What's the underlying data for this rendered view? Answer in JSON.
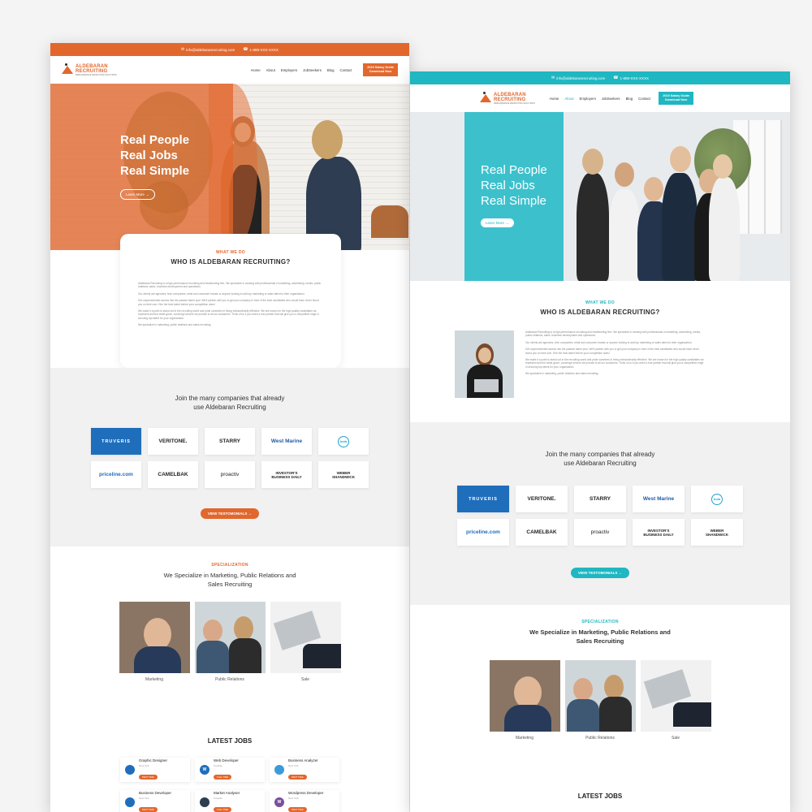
{
  "topbar": {
    "email": "info@aldebaranrecruiting.com",
    "phone": "1-888-XXX-XXXX"
  },
  "logo": {
    "name": "ALDEBARAN",
    "line2": "RECRUITING",
    "tagline": "PERFORMANCE RECRUITING SOLUTIONS"
  },
  "nav": {
    "items": [
      "Home",
      "About",
      "Employers",
      "JobSeekers",
      "Blog",
      "Contact"
    ],
    "cta_line1": "2019 Salary Guide",
    "cta_line2": "Download Now"
  },
  "hero": {
    "line1": "Real People",
    "line2": "Real Jobs",
    "line3": "Real Simple",
    "button": "Learn More →"
  },
  "about": {
    "eyebrow": "WHAT WE DO",
    "title": "WHO IS ALDEBARAN RECRUITING?",
    "p1": "Aldebaran Recruiting is a high-performance recruiting and headhunting firm. We specialize in working with professionals in marketing, advertising, media, public relations, sales, business development and operations.",
    "p2": "Our clients are agencies, tech companies, retail and consumer brands or anyone looking to add top marketing or sales talent to their organization.",
    "p3": "Get unprecedented access into the passive talent pool. We'll partner with you to get your company in front of the best candidates who would have never found you on their own. Hire the best talent before your competition does!",
    "p4": "We make it a point to stand out in the recruiting world and pride ourselves in being extraordinarily effective. We are known for the high quality candidates we represent and the white-glove, concierge service we provide to all our customers. Think of us if you need a true partner that will give you a competitive edge in securing top talent for your organization.",
    "p5": "We specialize in marketing, public relations and sales recruiting."
  },
  "clients": {
    "title_line1": "Join the many companies that already",
    "title_line2": "use Aldebaran Recruiting",
    "logos": [
      "TRUVERIS",
      "VERITONE.",
      "STARRY",
      "West Marine",
      "koia",
      "priceline.com",
      "CAMELBAK",
      "proactiv",
      "INVESTOR'S BUSINESS DAILY",
      "WEBER SHANDWICK"
    ],
    "button": "VIEW TESTOMONIALS →"
  },
  "specialization": {
    "eyebrow": "SPECIALIZATION",
    "title_line1": "We Specialize in Marketing, Public Relations and",
    "title_line2": "Sales Recruiting",
    "items": [
      "Marketing",
      "Public Relations",
      "Sale"
    ]
  },
  "jobs": {
    "title": "LATEST JOBS",
    "items": [
      {
        "title": "Graphic Designer",
        "location": "New York",
        "tag": "PART TIME"
      },
      {
        "title": "Web Developer",
        "location": "Canada",
        "tag": "FULL TIME"
      },
      {
        "title": "Business Analyzer",
        "location": "New York",
        "tag": "PART TIME"
      },
      {
        "title": "Business Developer",
        "location": "New York",
        "tag": "PART TIME"
      },
      {
        "title": "Market Analyser",
        "location": "Canada",
        "tag": "FULL TIME"
      },
      {
        "title": "Wordpress Developer",
        "location": "New York",
        "tag": "PART TIME"
      }
    ]
  },
  "colors": {
    "orange": "#e2672d",
    "teal": "#1fb7c1"
  }
}
